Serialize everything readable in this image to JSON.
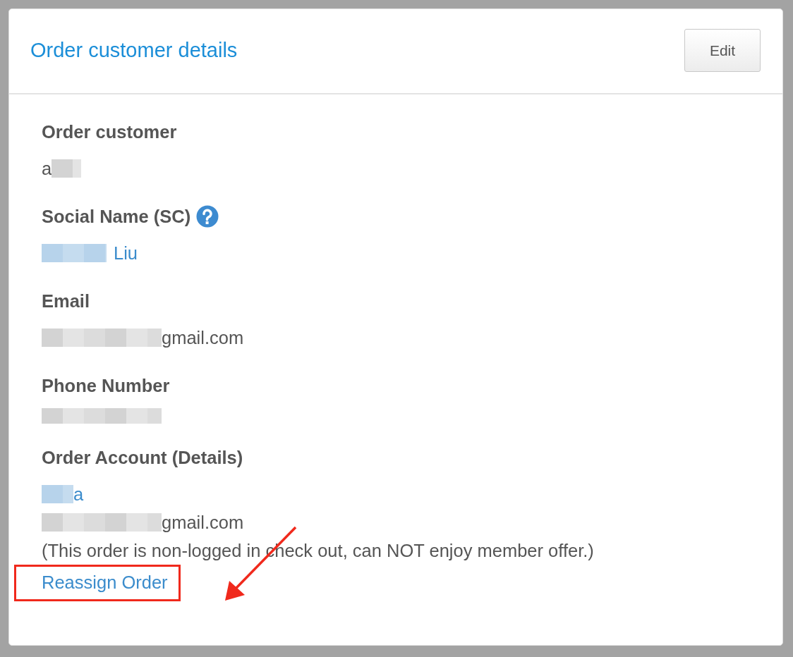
{
  "card": {
    "title": "Order customer details",
    "edit_button": "Edit"
  },
  "fields": [
    {
      "label": "Order customer",
      "help": false,
      "lines": [
        {
          "parts": [
            {
              "kind": "text",
              "text": "a"
            },
            {
              "kind": "redaction"
            }
          ]
        }
      ]
    },
    {
      "label": "Social Name (SC)",
      "help": true,
      "lines": [
        {
          "parts": [
            {
              "kind": "redaction"
            },
            {
              "kind": "link",
              "text": "Liu"
            }
          ]
        }
      ]
    },
    {
      "label": "Email",
      "help": false,
      "lines": [
        {
          "parts": [
            {
              "kind": "redaction"
            },
            {
              "kind": "text",
              "text": "gmail.com"
            }
          ]
        }
      ]
    },
    {
      "label": "Phone Number",
      "help": false,
      "lines": [
        {
          "parts": [
            {
              "kind": "redaction"
            }
          ]
        }
      ]
    },
    {
      "label": "Order Account (Details)",
      "help": false,
      "lines": [
        {
          "parts": [
            {
              "kind": "redaction"
            },
            {
              "kind": "link",
              "text": "a"
            }
          ]
        },
        {
          "parts": [
            {
              "kind": "redaction"
            },
            {
              "kind": "text",
              "text": "gmail.com"
            }
          ]
        },
        {
          "parts": [
            {
              "kind": "text",
              "text": "(This order is non-logged in check out, can NOT enjoy member offer.)"
            }
          ]
        },
        {
          "parts": [
            {
              "kind": "action",
              "text": "Reassign Order",
              "highlighted": true
            }
          ]
        }
      ]
    }
  ]
}
